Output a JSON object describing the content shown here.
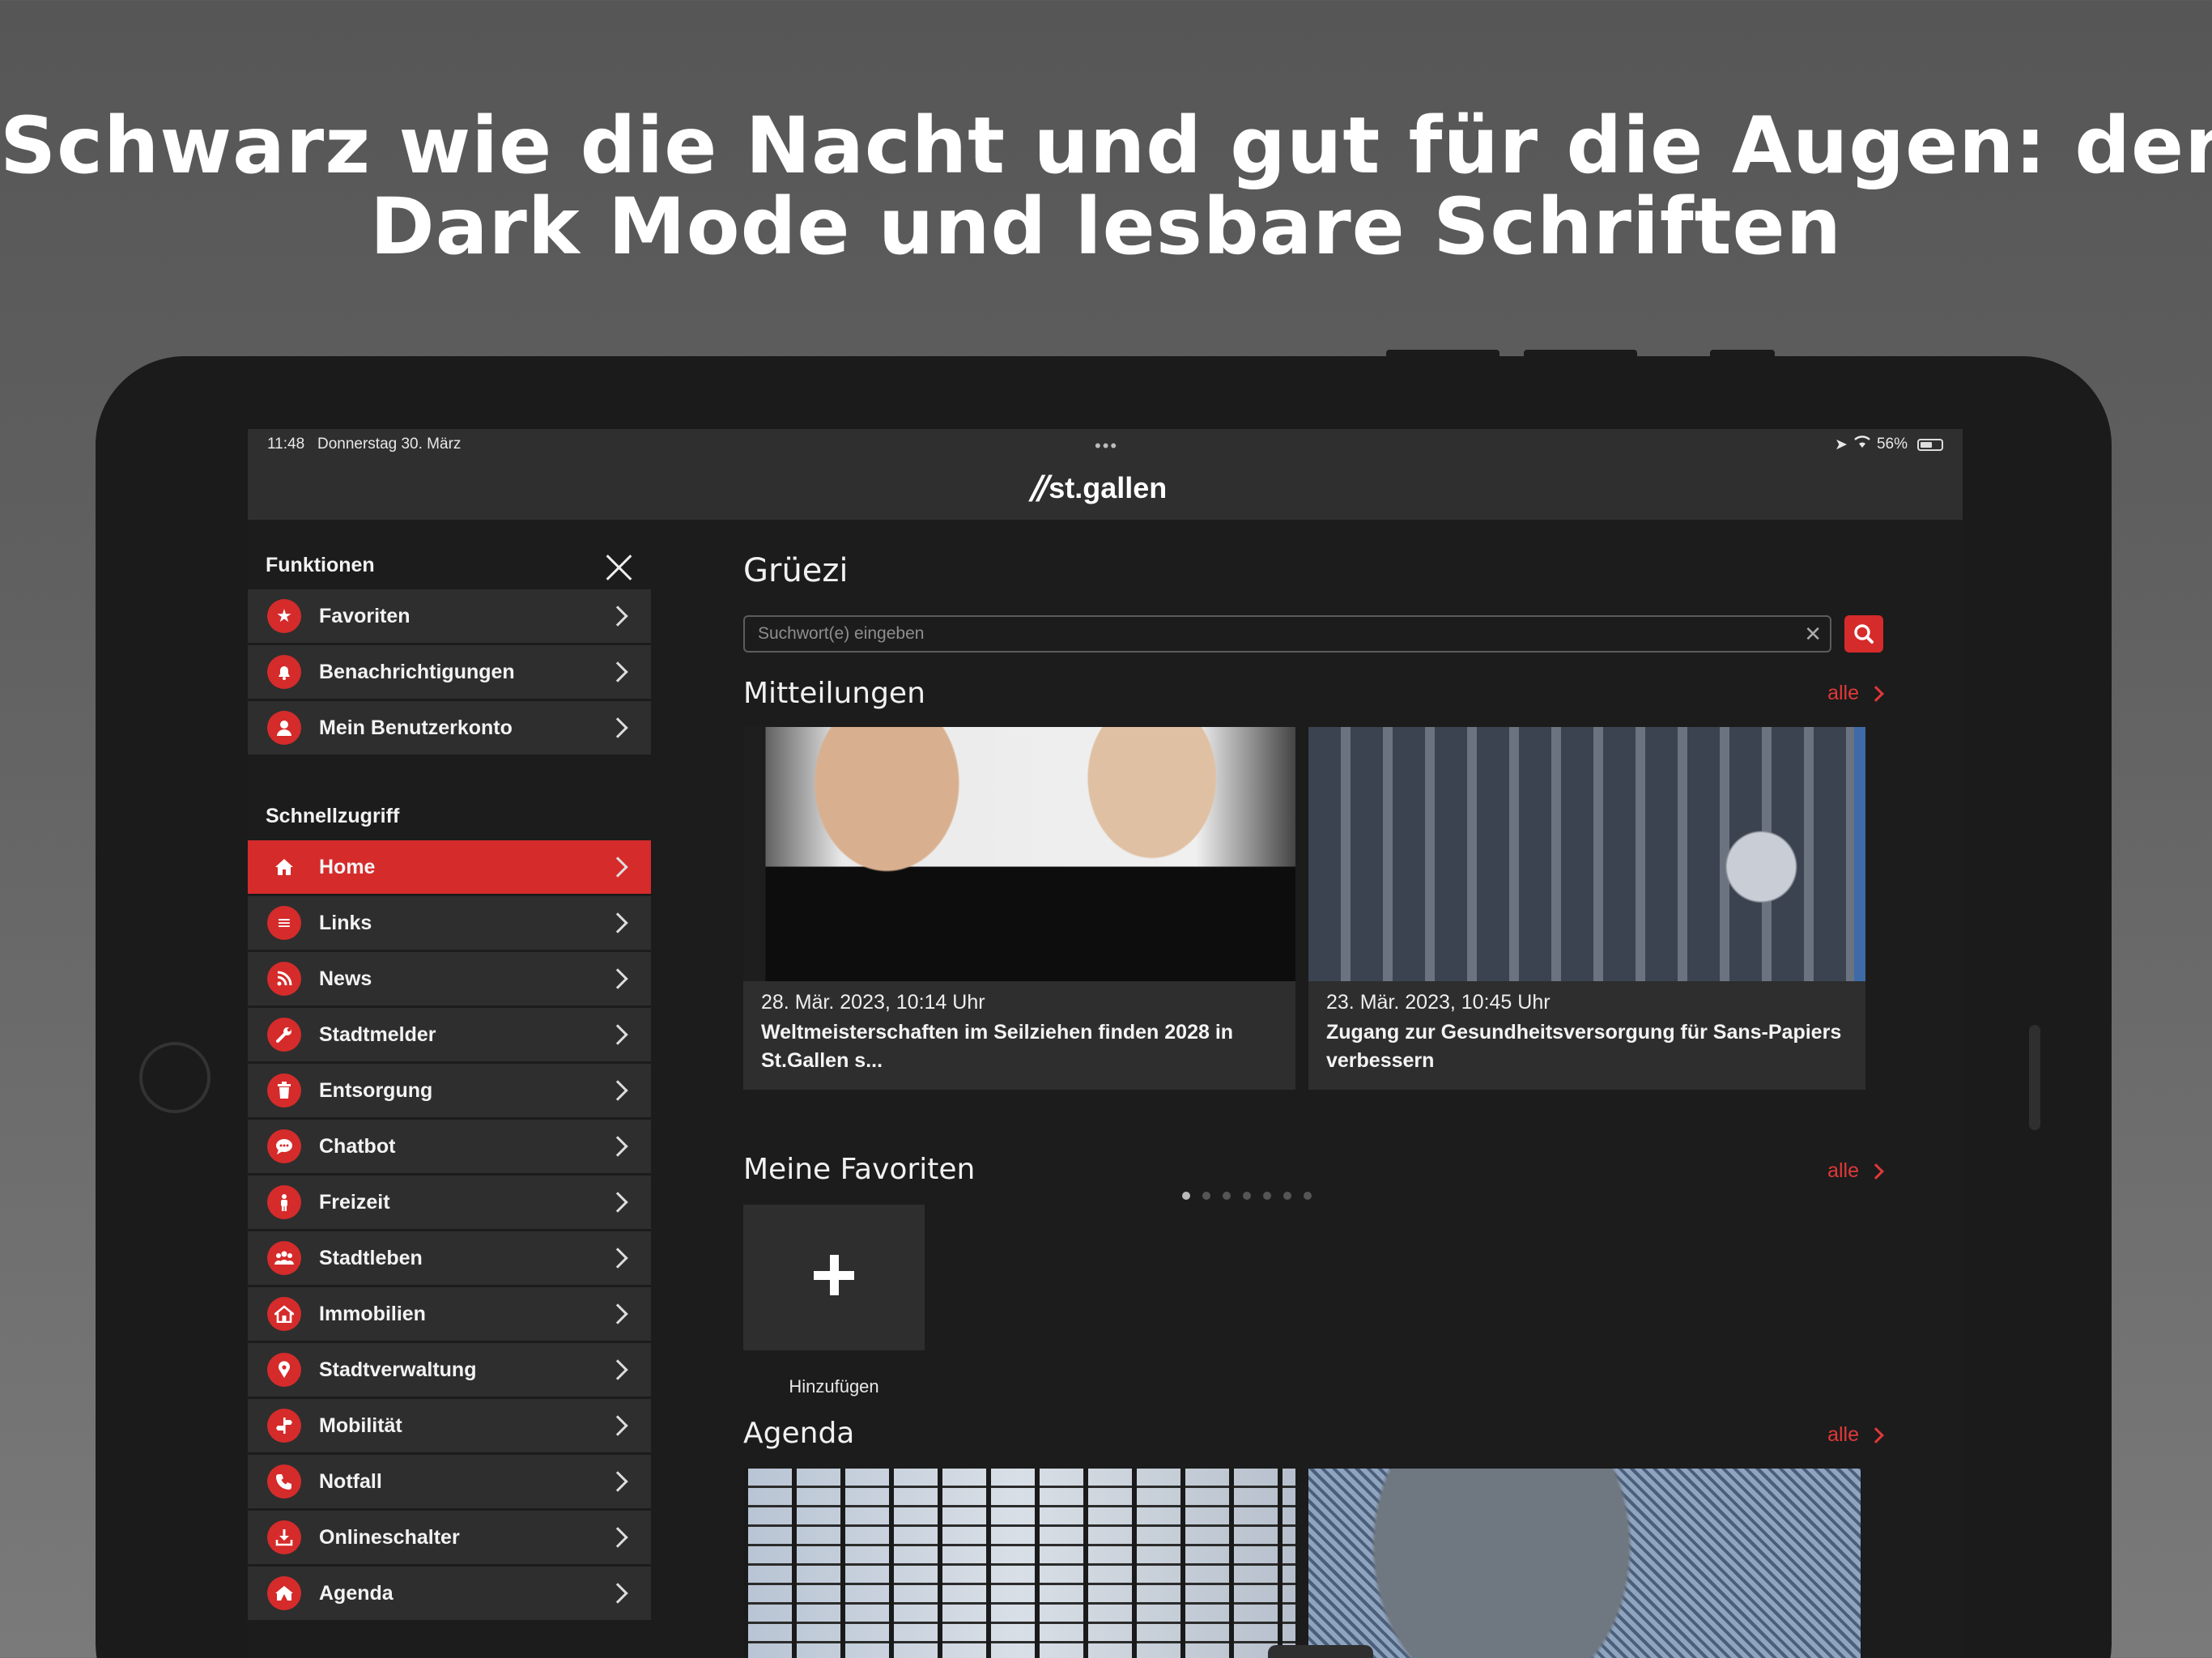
{
  "headline": {
    "line1": "Schwarz wie die Nacht und gut für die Augen: der",
    "line2": "Dark Mode und lesbare Schriften"
  },
  "status_bar": {
    "time": "11:48",
    "date": "Donnerstag 30. März",
    "battery": "56%",
    "icons": [
      "location-arrow-icon",
      "wifi-icon",
      "battery-icon"
    ]
  },
  "header": {
    "logo_mark": "//",
    "logo_text": "st.gallen"
  },
  "sidebar": {
    "close_icon": "close-icon",
    "section_functions": "Funktionen",
    "functions": [
      {
        "label": "Favoriten",
        "icon": "star-icon"
      },
      {
        "label": "Benachrichtigungen",
        "icon": "bell-icon"
      },
      {
        "label": "Mein Benutzerkonto",
        "icon": "user-icon"
      }
    ],
    "section_quick": "Schnellzugriff",
    "quick": [
      {
        "label": "Home",
        "icon": "home-icon",
        "active": true
      },
      {
        "label": "Links",
        "icon": "list-icon"
      },
      {
        "label": "News",
        "icon": "rss-icon"
      },
      {
        "label": "Stadtmelder",
        "icon": "wrench-icon"
      },
      {
        "label": "Entsorgung",
        "icon": "trash-icon"
      },
      {
        "label": "Chatbot",
        "icon": "chat-icon"
      },
      {
        "label": "Freizeit",
        "icon": "person-icon"
      },
      {
        "label": "Stadtleben",
        "icon": "people-icon"
      },
      {
        "label": "Immobilien",
        "icon": "house-icon"
      },
      {
        "label": "Stadtverwaltung",
        "icon": "map-pin-icon"
      },
      {
        "label": "Mobilität",
        "icon": "signpost-icon"
      },
      {
        "label": "Notfall",
        "icon": "phone-icon"
      },
      {
        "label": "Onlineschalter",
        "icon": "download-tray-icon"
      },
      {
        "label": "Agenda",
        "icon": "tent-icon"
      }
    ]
  },
  "main": {
    "greeting": "Grüezi",
    "search": {
      "placeholder": "Suchwort(e) eingeben",
      "value": ""
    },
    "mitteilungen": {
      "title": "Mitteilungen",
      "alle": "alle",
      "cards": [
        {
          "date": "28. Mär. 2023, 10:14 Uhr",
          "title": "Weltmeisterschaften im Seilziehen finden 2028 in St.Gallen s..."
        },
        {
          "date": "23. Mär. 2023, 10:45 Uhr",
          "title": "Zugang zur Gesundheitsversorgung für Sans-Papiers verbessern"
        }
      ],
      "page_count": 7,
      "active_page": 1
    },
    "favoriten": {
      "title": "Meine Favoriten",
      "alle": "alle",
      "add_label": "Hinzufügen"
    },
    "agenda": {
      "title": "Agenda",
      "alle": "alle"
    }
  },
  "colors": {
    "accent": "#d52b2b",
    "background": "#1c1c1c",
    "row": "#2e2e2e"
  }
}
